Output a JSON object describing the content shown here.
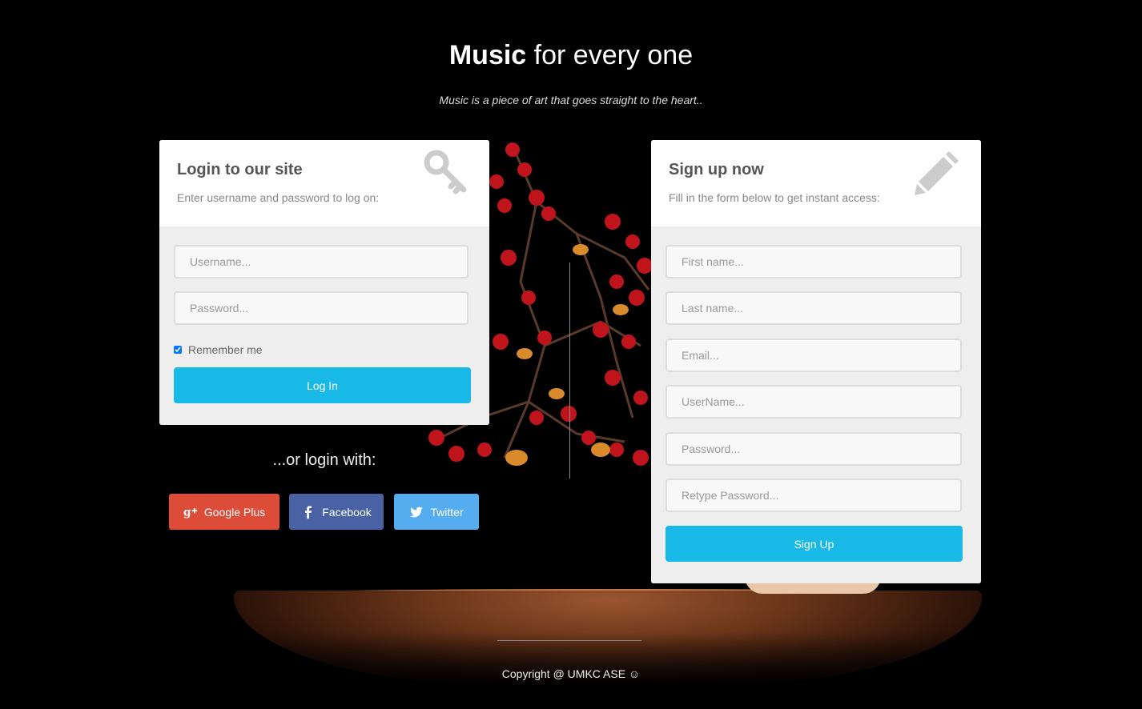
{
  "header": {
    "title_bold": "Music",
    "title_light": "for every one",
    "tagline": "Music is a piece of art that goes straight to the heart.."
  },
  "login": {
    "title": "Login to our site",
    "subtitle": "Enter username and password to log on:",
    "icon": "key-icon",
    "username_placeholder": "Username...",
    "password_placeholder": "Password...",
    "remember_label": "Remember me",
    "remember_checked": true,
    "submit_label": "Log In"
  },
  "social": {
    "heading": "...or login with:",
    "buttons": [
      {
        "label": "Google Plus",
        "icon": "google-plus-icon",
        "color": "#dd4b39"
      },
      {
        "label": "Facebook",
        "icon": "facebook-icon",
        "color": "#4862a3"
      },
      {
        "label": "Twitter",
        "icon": "twitter-icon",
        "color": "#55acee"
      }
    ]
  },
  "signup": {
    "title": "Sign up now",
    "subtitle": "Fill in the form below to get instant access:",
    "icon": "pencil-icon",
    "first_name_placeholder": "First name...",
    "last_name_placeholder": "Last name...",
    "email_placeholder": "Email...",
    "username_placeholder": "UserName...",
    "password_placeholder": "Password...",
    "retype_password_placeholder": "Retype Password...",
    "submit_label": "Sign Up"
  },
  "footer": {
    "copyright": "Copyright @ UMKC ASE ☺"
  },
  "colors": {
    "accent": "#19b9e7",
    "background": "#000000",
    "panel_body": "#eeeeee"
  }
}
